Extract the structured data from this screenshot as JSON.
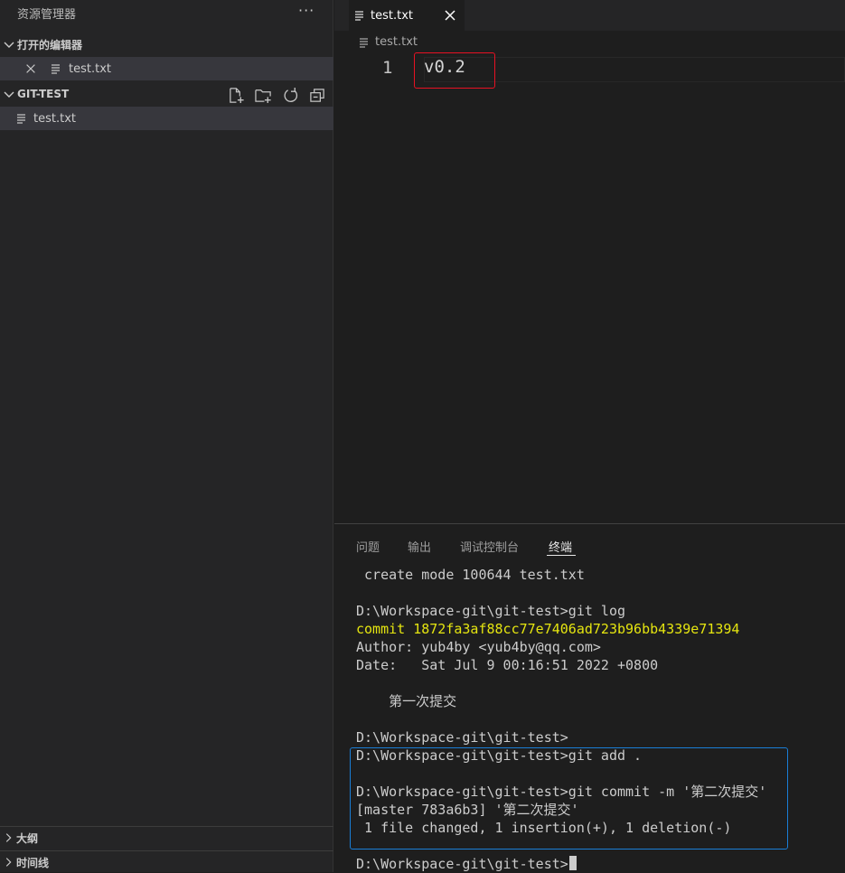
{
  "sidebar": {
    "title": "资源管理器",
    "more_label": "···",
    "open_editors": {
      "label": "打开的编辑器",
      "files": [
        {
          "name": "test.txt"
        }
      ]
    },
    "workspace": {
      "label": "GIT-TEST",
      "actions": [
        "new-file",
        "new-folder",
        "refresh",
        "collapse-all"
      ],
      "files": [
        {
          "name": "test.txt"
        }
      ]
    },
    "bottom_sections": [
      {
        "label": "大纲"
      },
      {
        "label": "时间线"
      }
    ]
  },
  "editor": {
    "tab": {
      "name": "test.txt"
    },
    "breadcrumb": "test.txt",
    "lines": [
      {
        "number": "1",
        "text": "v0.2"
      }
    ]
  },
  "panel": {
    "tabs": [
      {
        "label": "问题"
      },
      {
        "label": "输出"
      },
      {
        "label": "调试控制台"
      },
      {
        "label": "终端"
      }
    ],
    "active_tab": "终端",
    "terminal_lines": [
      " create mode 100644 test.txt",
      "",
      "D:\\Workspace-git\\git-test>git log",
      "commit 1872fa3af88cc77e7406ad723b96bb4339e71394",
      "Author: yub4by <yub4by@qq.com>",
      "Date:   Sat Jul 9 00:16:51 2022 +0800",
      "",
      "    第一次提交",
      "",
      "D:\\Workspace-git\\git-test>",
      "D:\\Workspace-git\\git-test>git add .",
      "",
      "D:\\Workspace-git\\git-test>git commit -m '第二次提交'",
      "[master 783a6b3] '第二次提交'",
      " 1 file changed, 1 insertion(+), 1 deletion(-)",
      "",
      "D:\\Workspace-git\\git-test>"
    ]
  },
  "colors": {
    "background": "#1e1e1e",
    "sidebar": "#252526",
    "selection": "#37373d",
    "commit_hash": "#e5e510",
    "highlight_red": "#e81123",
    "highlight_blue": "#1a7ed6"
  }
}
